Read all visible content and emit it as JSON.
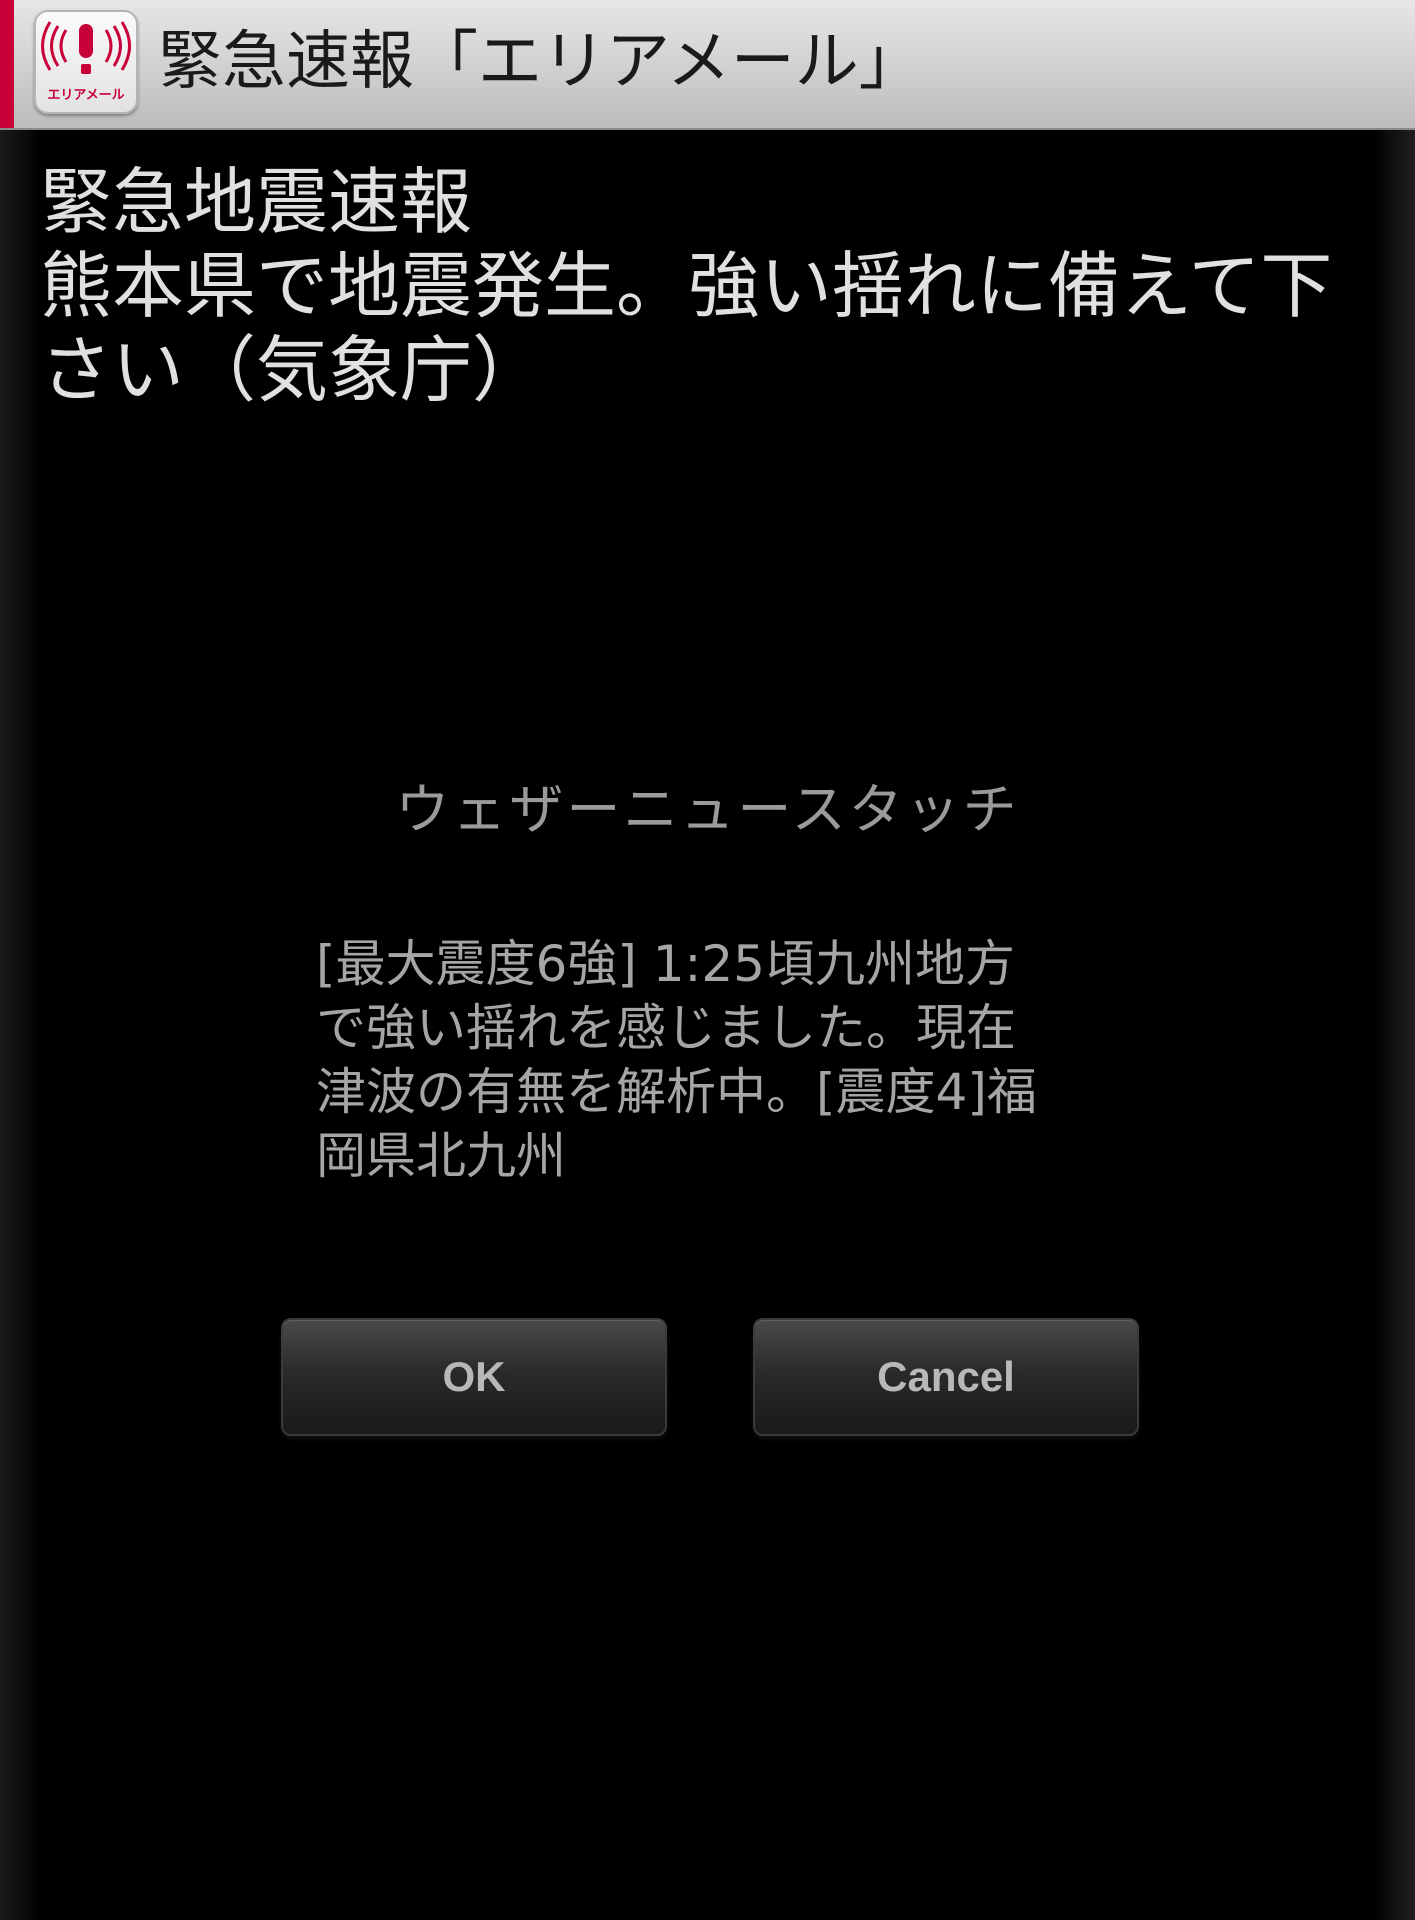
{
  "app": {
    "title": "緊急速報「エリアメール」",
    "icon_label": "エリアメール",
    "icon": "alert-broadcast-icon",
    "accent_color": "#c8003a"
  },
  "alert": {
    "lines": [
      "緊急地震速報",
      "熊本県で地震発生。強い揺れに備えて下",
      "さい（気象庁）"
    ]
  },
  "dialog": {
    "title": "ウェザーニュースタッチ",
    "message_lines": [
      "[最大震度6強] 1:25頃九州地方",
      "で強い揺れを感じました。現在",
      "津波の有無を解析中。[震度4]福",
      "岡県北九州"
    ],
    "ok_label": "OK",
    "cancel_label": "Cancel"
  }
}
